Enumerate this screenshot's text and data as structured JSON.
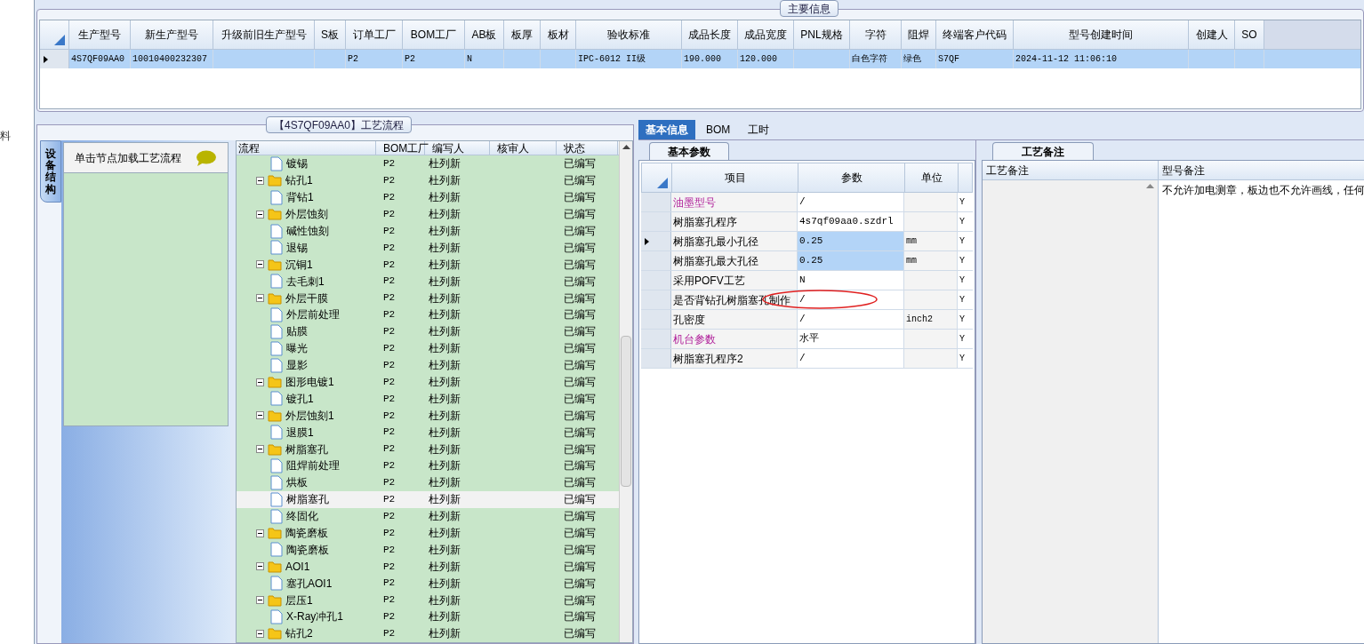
{
  "left_edge": {
    "text": "料"
  },
  "main_info": {
    "title": "主要信息",
    "columns": [
      "生产型号",
      "新生产型号",
      "升级前旧生产型号",
      "S板",
      "订单工厂",
      "BOM工厂",
      "AB板",
      "板厚",
      "板材",
      "验收标准",
      "成品长度",
      "成品宽度",
      "PNL规格",
      "字符",
      "阻焊",
      "终端客户代码",
      "型号创建时间",
      "创建人",
      "SO"
    ],
    "rows": [
      {
        "selected": true,
        "current": true,
        "cells": [
          "4S7QF09AA0",
          "10010400232307",
          null,
          null,
          "P2",
          "P2",
          "N",
          null,
          null,
          "IPC-6012 II级",
          "190.000",
          "120.000",
          null,
          "白色字符",
          "绿色",
          "S7QF",
          "2024-11-12 11:06:10",
          null,
          null
        ]
      }
    ]
  },
  "process": {
    "title": "【4S7QF09AA0】工艺流程",
    "side_tab": "设备结构",
    "hint": "单击节点加载工艺流程",
    "columns": [
      "流程",
      "BOM工厂",
      "编写人",
      "核审人",
      "状态"
    ],
    "rows": [
      {
        "kind": "file",
        "label": "镀锡",
        "factory": "P2",
        "writer": "杜列新",
        "status": "已编写",
        "selected": false
      },
      {
        "kind": "folder",
        "label": "钻孔1",
        "factory": "P2",
        "writer": "杜列新",
        "status": "已编写",
        "selected": false,
        "expanded": true,
        "children": [
          {
            "kind": "file",
            "label": "背钻1",
            "factory": "P2",
            "writer": "杜列新",
            "status": "已编写",
            "selected": false
          }
        ]
      },
      {
        "kind": "folder",
        "label": "外层蚀刻",
        "factory": "P2",
        "writer": "杜列新",
        "status": "已编写",
        "selected": false,
        "expanded": true,
        "children": [
          {
            "kind": "file",
            "label": "碱性蚀刻",
            "factory": "P2",
            "writer": "杜列新",
            "status": "已编写",
            "selected": false
          },
          {
            "kind": "file",
            "label": "退锡",
            "factory": "P2",
            "writer": "杜列新",
            "status": "已编写",
            "selected": false
          }
        ]
      },
      {
        "kind": "folder",
        "label": "沉铜1",
        "factory": "P2",
        "writer": "杜列新",
        "status": "已编写",
        "selected": false,
        "expanded": true,
        "children": [
          {
            "kind": "file",
            "label": "去毛刺1",
            "factory": "P2",
            "writer": "杜列新",
            "status": "已编写",
            "selected": false
          }
        ]
      },
      {
        "kind": "folder",
        "label": "外层干膜",
        "factory": "P2",
        "writer": "杜列新",
        "status": "已编写",
        "selected": false,
        "expanded": true,
        "children": [
          {
            "kind": "file",
            "label": "外层前处理",
            "factory": "P2",
            "writer": "杜列新",
            "status": "已编写",
            "selected": false
          },
          {
            "kind": "file",
            "label": "贴膜",
            "factory": "P2",
            "writer": "杜列新",
            "status": "已编写",
            "selected": false
          },
          {
            "kind": "file",
            "label": "曝光",
            "factory": "P2",
            "writer": "杜列新",
            "status": "已编写",
            "selected": false
          },
          {
            "kind": "file",
            "label": "显影",
            "factory": "P2",
            "writer": "杜列新",
            "status": "已编写",
            "selected": false
          }
        ]
      },
      {
        "kind": "folder",
        "label": "图形电镀1",
        "factory": "P2",
        "writer": "杜列新",
        "status": "已编写",
        "selected": false,
        "expanded": true,
        "children": [
          {
            "kind": "file",
            "label": "镀孔1",
            "factory": "P2",
            "writer": "杜列新",
            "status": "已编写",
            "selected": false
          }
        ]
      },
      {
        "kind": "folder",
        "label": "外层蚀刻1",
        "factory": "P2",
        "writer": "杜列新",
        "status": "已编写",
        "selected": false,
        "expanded": true,
        "children": [
          {
            "kind": "file",
            "label": "退膜1",
            "factory": "P2",
            "writer": "杜列新",
            "status": "已编写",
            "selected": false
          }
        ]
      },
      {
        "kind": "folder",
        "label": "树脂塞孔",
        "factory": "P2",
        "writer": "杜列新",
        "status": "已编写",
        "selected": false,
        "expanded": true,
        "children": [
          {
            "kind": "file",
            "label": "阻焊前处理",
            "factory": "P2",
            "writer": "杜列新",
            "status": "已编写",
            "selected": false
          },
          {
            "kind": "file",
            "label": "烘板",
            "factory": "P2",
            "writer": "杜列新",
            "status": "已编写",
            "selected": false
          },
          {
            "kind": "file",
            "label": "树脂塞孔",
            "factory": "P2",
            "writer": "杜列新",
            "status": "已编写",
            "selected": true
          },
          {
            "kind": "file",
            "label": "终固化",
            "factory": "P2",
            "writer": "杜列新",
            "status": "已编写",
            "selected": false
          }
        ]
      },
      {
        "kind": "folder",
        "label": "陶瓷磨板",
        "factory": "P2",
        "writer": "杜列新",
        "status": "已编写",
        "selected": false,
        "expanded": true,
        "children": [
          {
            "kind": "file",
            "label": "陶瓷磨板",
            "factory": "P2",
            "writer": "杜列新",
            "status": "已编写",
            "selected": false
          }
        ]
      },
      {
        "kind": "folder",
        "label": "AOI1",
        "factory": "P2",
        "writer": "杜列新",
        "status": "已编写",
        "selected": false,
        "expanded": true,
        "children": [
          {
            "kind": "file",
            "label": "塞孔AOI1",
            "factory": "P2",
            "writer": "杜列新",
            "status": "已编写",
            "selected": false
          }
        ]
      },
      {
        "kind": "folder",
        "label": "层压1",
        "factory": "P2",
        "writer": "杜列新",
        "status": "已编写",
        "selected": false,
        "expanded": true,
        "children": [
          {
            "kind": "file",
            "label": "X-Ray冲孔1",
            "factory": "P2",
            "writer": "杜列新",
            "status": "已编写",
            "selected": false
          }
        ]
      },
      {
        "kind": "folder",
        "label": "钻孔2",
        "factory": "P2",
        "writer": "杜列新",
        "status": "已编写",
        "selected": false,
        "expanded": true
      }
    ]
  },
  "detail": {
    "tabs": [
      {
        "label": "基本信息",
        "selected": true
      },
      {
        "label": "BOM",
        "selected": false
      },
      {
        "label": "工时",
        "selected": false
      }
    ],
    "params_tab": "基本参数",
    "columns": [
      "项目",
      "参数",
      "单位"
    ],
    "rows": [
      {
        "kind": "category",
        "item": "油墨型号",
        "value": "/",
        "flag": "Y",
        "current": false,
        "selected": false
      },
      {
        "kind": "param",
        "item": "树脂塞孔程序",
        "value": "4s7qf09aa0.szdrl",
        "flag": "Y",
        "current": false,
        "selected": false
      },
      {
        "kind": "param",
        "item": "树脂塞孔最小孔径",
        "value": "0.25",
        "unit": "mm",
        "flag": "Y",
        "current": true,
        "selected": true
      },
      {
        "kind": "param",
        "item": "树脂塞孔最大孔径",
        "value": "0.25",
        "unit": "mm",
        "flag": "Y",
        "current": false,
        "selected": true
      },
      {
        "kind": "param",
        "item": "采用POFV工艺",
        "value": "N",
        "flag": "Y",
        "current": false,
        "selected": false
      },
      {
        "kind": "param",
        "item": "是否背钻孔树脂塞孔制作",
        "value": "/",
        "flag": "Y",
        "current": false,
        "selected": false,
        "circled": true
      },
      {
        "kind": "param",
        "item": "孔密度",
        "value": "/",
        "unit": "inch2",
        "flag": "Y",
        "current": false,
        "selected": false
      },
      {
        "kind": "category",
        "item": "机台参数",
        "value": "水平",
        "flag": "Y",
        "current": false,
        "selected": false
      },
      {
        "kind": "param",
        "item": "树脂塞孔程序2",
        "value": "/",
        "flag": "Y",
        "current": false,
        "selected": false
      }
    ]
  },
  "notes": {
    "tab": "工艺备注",
    "columns": [
      "工艺备注",
      "型号备注"
    ],
    "model_note": "不允许加电测章，板边也不允许画线，任何"
  }
}
